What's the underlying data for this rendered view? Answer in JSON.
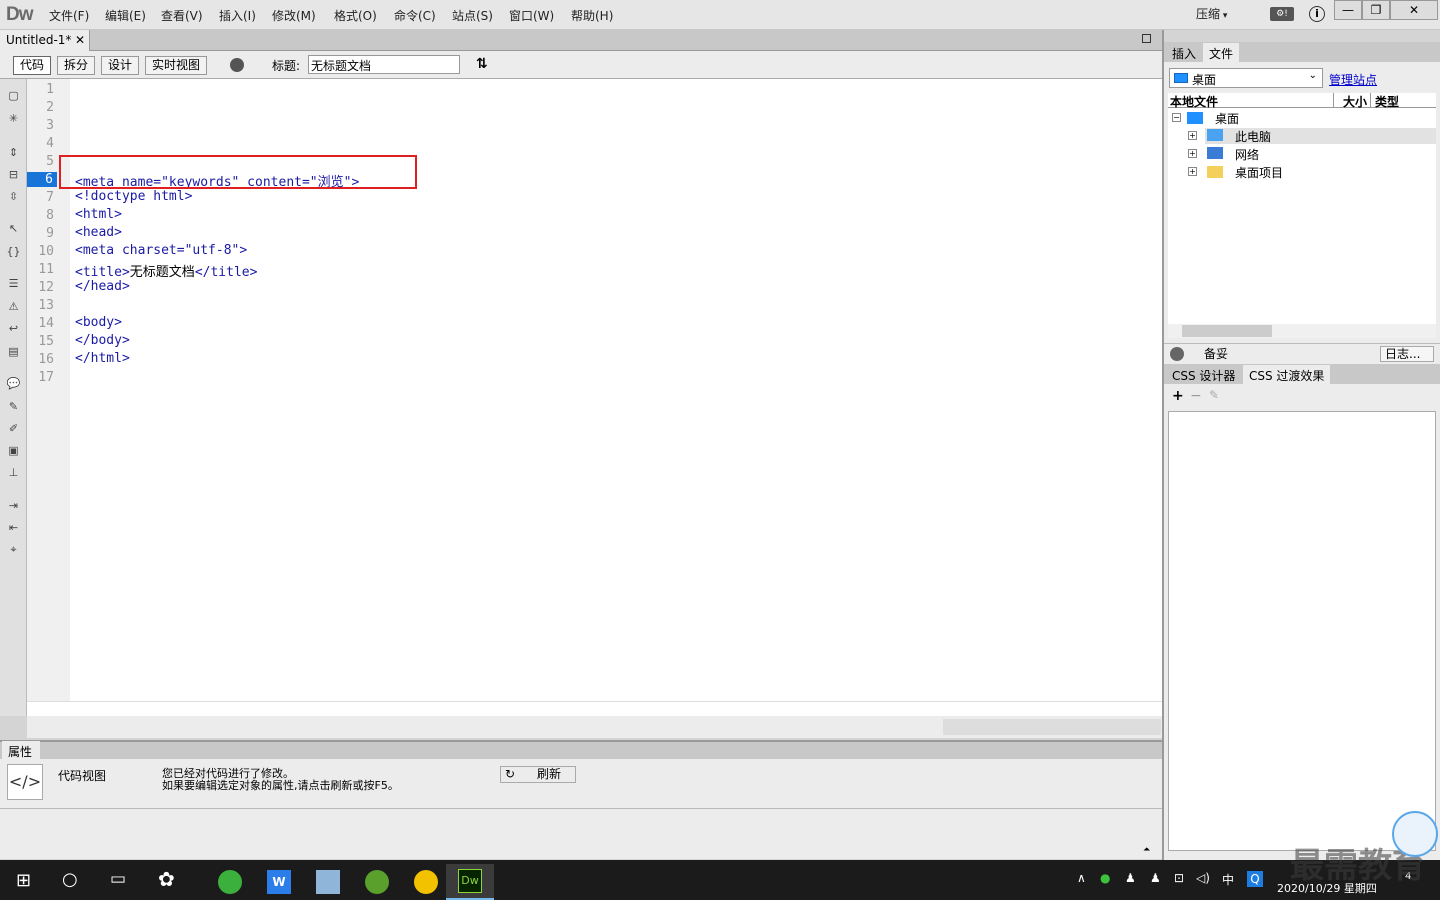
{
  "menubar": {
    "logo": "Dw",
    "items": [
      "文件(F)",
      "编辑(E)",
      "查看(V)",
      "插入(I)",
      "修改(M)",
      "格式(O)",
      "命令(C)",
      "站点(S)",
      "窗口(W)",
      "帮助(H)"
    ],
    "compress": "压缩"
  },
  "document": {
    "tab_name": "Untitled-1*",
    "views": [
      "代码",
      "拆分",
      "设计",
      "实时视图"
    ],
    "title_label": "标题:",
    "title_value": "无标题文档"
  },
  "editor": {
    "line_numbers": [
      "1",
      "2",
      "3",
      "4",
      "5",
      "6",
      "7",
      "8",
      "9",
      "10",
      "11",
      "12",
      "13",
      "14",
      "15",
      "16",
      "17"
    ],
    "current_line": "6",
    "lines": {
      "l6a": "<meta name=\"keywords\" content=\"",
      "l6b": "浏览",
      "l6c": "\">",
      "l7": "<!doctype html>",
      "l8": "<html>",
      "l9": "<head>",
      "l10": "<meta charset=\"utf-8\">",
      "l11a": "<title>",
      "l11b": "无标题文档",
      "l11c": "</title>",
      "l12": "</head>",
      "l14": "<body>",
      "l15": "</body>",
      "l16": "</html>"
    }
  },
  "properties": {
    "tab": "属性",
    "view_label": "代码视图",
    "message_line1": "您已经对代码进行了修改。",
    "message_line2": "如果要编辑选定对象的属性,请点击刷新或按F5。",
    "refresh": "刷新"
  },
  "files_panel": {
    "tabs": [
      "插入",
      "文件"
    ],
    "site": "桌面",
    "manage_sites": "管理站点",
    "col_local": "本地文件",
    "col_size": "大小",
    "col_type": "类型",
    "tree": [
      "桌面",
      "此电脑",
      "网络",
      "桌面项目"
    ],
    "foot_label": "备妥",
    "log_button": "日志..."
  },
  "css_panel": {
    "tabs": [
      "CSS 设计器",
      "CSS 过渡效果"
    ]
  },
  "taskbar": {
    "ime": "中",
    "date": "2020/10/29 星期四",
    "notifications": "4"
  },
  "watermark": "最需教育"
}
